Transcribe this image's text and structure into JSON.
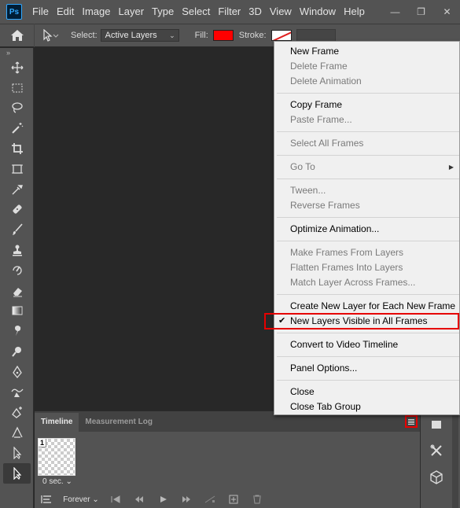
{
  "app": {
    "logo_text": "Ps"
  },
  "menubar": {
    "items": [
      "File",
      "Edit",
      "Image",
      "Layer",
      "Type",
      "Select",
      "Filter",
      "3D",
      "View",
      "Window",
      "Help"
    ],
    "window_buttons": {
      "minimize": "—",
      "restore": "❐",
      "close": "✕"
    }
  },
  "options_bar": {
    "select_label": "Select:",
    "select_value": "Active Layers",
    "fill_label": "Fill:",
    "fill_color": "#ff0000",
    "stroke_label": "Stroke:"
  },
  "toolbar": {
    "collapse": "»",
    "tools": [
      "move-tool-icon",
      "marquee-tool-icon",
      "lasso-tool-icon",
      "magic-wand-icon",
      "crop-tool-icon",
      "frame-tool-icon",
      "eyedropper-icon",
      "healing-brush-icon",
      "brush-tool-icon",
      "clone-stamp-icon",
      "history-brush-icon",
      "eraser-icon",
      "gradient-tool-icon",
      "smudge-tool-icon",
      "dodge-tool-icon",
      "pen-tool-icon",
      "freeform-pen-icon",
      "add-anchor-icon",
      "convert-point-icon",
      "path-select-icon",
      "direct-select-icon"
    ]
  },
  "timeline": {
    "tabs": [
      "Timeline",
      "Measurement Log"
    ],
    "frame_number": "1",
    "frame_delay": "0 sec.",
    "loop": "Forever"
  },
  "flyout_menu": {
    "groups": [
      [
        {
          "label": "New Frame",
          "enabled": true
        },
        {
          "label": "Delete Frame",
          "enabled": false
        },
        {
          "label": "Delete Animation",
          "enabled": false
        }
      ],
      [
        {
          "label": "Copy Frame",
          "enabled": true
        },
        {
          "label": "Paste Frame...",
          "enabled": false
        }
      ],
      [
        {
          "label": "Select All Frames",
          "enabled": false
        }
      ],
      [
        {
          "label": "Go To",
          "enabled": false,
          "submenu": true
        }
      ],
      [
        {
          "label": "Tween...",
          "enabled": false
        },
        {
          "label": "Reverse Frames",
          "enabled": false
        }
      ],
      [
        {
          "label": "Optimize Animation...",
          "enabled": true
        }
      ],
      [
        {
          "label": "Make Frames From Layers",
          "enabled": false
        },
        {
          "label": "Flatten Frames Into Layers",
          "enabled": false
        },
        {
          "label": "Match Layer Across Frames...",
          "enabled": false
        }
      ],
      [
        {
          "label": "Create New Layer for Each New Frame",
          "enabled": true
        },
        {
          "label": "New Layers Visible in All Frames",
          "enabled": true,
          "checked": true,
          "highlighted": true
        }
      ],
      [
        {
          "label": "Convert to Video Timeline",
          "enabled": true
        }
      ],
      [
        {
          "label": "Panel Options...",
          "enabled": true
        }
      ],
      [
        {
          "label": "Close",
          "enabled": true
        },
        {
          "label": "Close Tab Group",
          "enabled": true
        }
      ]
    ]
  },
  "colors": {
    "highlight": "#e60000",
    "ui_bg": "#535353",
    "canvas_bg": "#282828",
    "menu_bg": "#f0f0f0"
  }
}
